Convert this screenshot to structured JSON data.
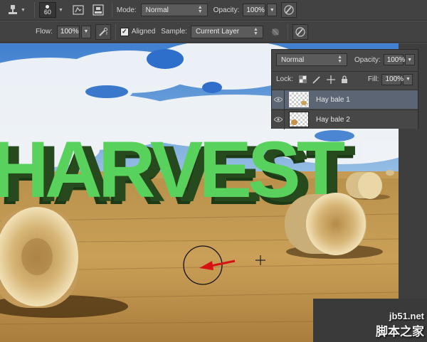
{
  "tool_options": {
    "brush_size": "60",
    "mode_label": "Mode:",
    "mode_value": "Normal",
    "opacity_label": "Opacity:",
    "opacity_value": "100%",
    "flow_label": "Flow:",
    "flow_value": "100%",
    "aligned_label": "Aligned",
    "aligned_checked": true,
    "sample_label": "Sample:",
    "sample_value": "Current Layer"
  },
  "layers_panel": {
    "blend_mode": "Normal",
    "opacity_label": "Opacity:",
    "opacity_value": "100%",
    "lock_label": "Lock:",
    "fill_label": "Fill:",
    "fill_value": "100%",
    "layers": [
      {
        "name": "Hay bale 1",
        "selected": true,
        "visible": true
      },
      {
        "name": "Hay bale 2",
        "selected": false,
        "visible": true
      }
    ]
  },
  "canvas": {
    "headline": "HARVEST",
    "headline_color": "#58d25c",
    "headline_shadow_color": "#1d3a17"
  },
  "watermark": {
    "site": "jb51.net",
    "cn": "脚本之家"
  },
  "icons": [
    "clone-stamp-tool-icon",
    "brush-preset-icon",
    "toggle-brush-panel-icon",
    "toggle-clone-source-icon",
    "pressure-opacity-icon",
    "pressure-size-icon",
    "ignore-adjustment-layers-icon",
    "eye-icon",
    "lock-transparent-icon",
    "lock-pixels-icon",
    "lock-position-icon",
    "lock-all-icon"
  ]
}
